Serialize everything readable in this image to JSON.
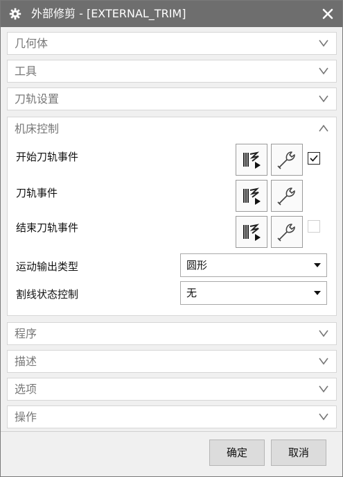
{
  "window": {
    "title": "外部修剪 - [EXTERNAL_TRIM]",
    "icon": "gear-icon",
    "close_icon": "close-icon"
  },
  "sections": {
    "geometry": {
      "label": "几何体",
      "state": "collapsed"
    },
    "tool": {
      "label": "工具",
      "state": "collapsed"
    },
    "path_settings": {
      "label": "刀轨设置",
      "state": "collapsed"
    },
    "machine_control": {
      "label": "机床控制",
      "state": "expanded"
    },
    "program": {
      "label": "程序",
      "state": "collapsed"
    },
    "description": {
      "label": "描述",
      "state": "collapsed"
    },
    "options": {
      "label": "选项",
      "state": "collapsed"
    },
    "actions": {
      "label": "操作",
      "state": "collapsed"
    }
  },
  "machine_control": {
    "rows": [
      {
        "label": "开始刀轨事件",
        "checkbox": true,
        "checked": true,
        "checkbox_enabled": true
      },
      {
        "label": "刀轨事件",
        "checkbox": false
      },
      {
        "label": "结束刀轨事件",
        "checkbox": true,
        "checked": false,
        "checkbox_enabled": false
      }
    ],
    "motion_output": {
      "label": "运动输出类型",
      "value": "圆形"
    },
    "line_state": {
      "label": "割线状态控制",
      "value": "无"
    }
  },
  "buttons": {
    "ok": "确定",
    "cancel": "取消"
  },
  "colors": {
    "titlebar": "#6e6e6e",
    "dialog_bg": "#f0f0f0",
    "panel_bg": "#ffffff",
    "button_bg": "#dcdcdc"
  }
}
